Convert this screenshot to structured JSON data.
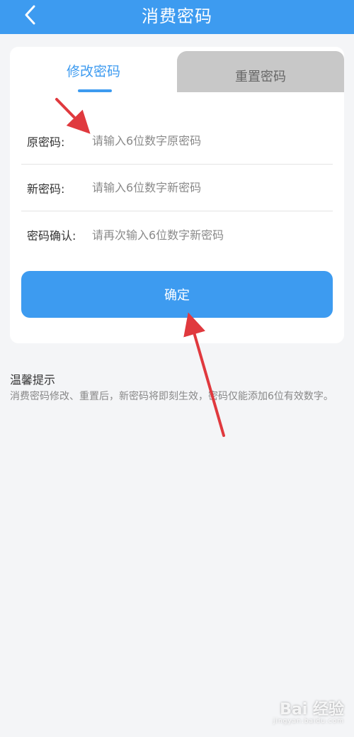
{
  "header": {
    "title": "消费密码",
    "back_icon": "chevron-left-icon"
  },
  "tabs": [
    {
      "label": "修改密码",
      "active": true
    },
    {
      "label": "重置密码",
      "active": false
    }
  ],
  "form": {
    "fields": [
      {
        "label": "原密码:",
        "placeholder": "请输入6位数字原密码",
        "value": ""
      },
      {
        "label": "新密码:",
        "placeholder": "请输入6位数字新密码",
        "value": ""
      },
      {
        "label": "密码确认:",
        "placeholder": "请再次输入6位数字新密码",
        "value": ""
      }
    ],
    "submit_label": "确定"
  },
  "tips": {
    "title": "温馨提示",
    "text": "消费密码修改、重置后，新密码将即刻生效，密码仅能添加6位有效数字。"
  },
  "watermark": {
    "text": "Bai 经验",
    "sub": "jingyan.baidu.com"
  },
  "colors": {
    "primary": "#3d9bf0",
    "inactive_tab": "#c8c8c8",
    "background": "#f4f5f7",
    "annotation": "#e0393e"
  }
}
